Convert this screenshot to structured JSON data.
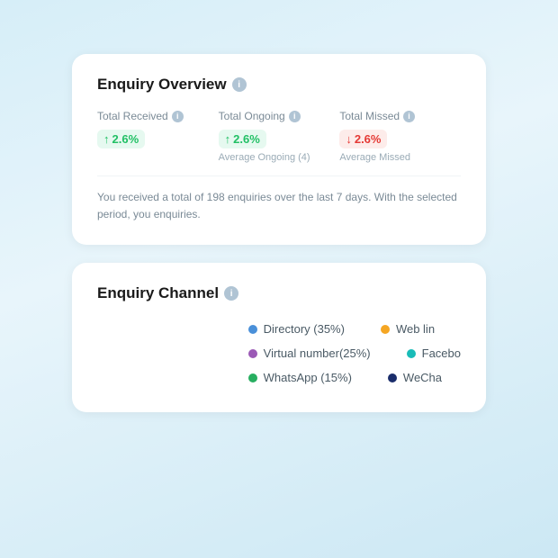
{
  "enquiryOverview": {
    "title": "Enquiry Overview",
    "infoIcon": "i",
    "stats": [
      {
        "label": "Total Received",
        "direction": "up",
        "value": "2.6%",
        "sub": ""
      },
      {
        "label": "Total Ongoing",
        "direction": "up",
        "value": "2.6%",
        "sub": "Average Ongoing (4)"
      },
      {
        "label": "Total Missed",
        "direction": "down",
        "value": "2.6%",
        "sub": "Average Missed"
      }
    ],
    "summary": "You received a total of 198 enquiries over the last 7 days. With the selected period, you enquiries."
  },
  "enquiryChannel": {
    "title": "Enquiry Channel",
    "infoIcon": "i",
    "legend": [
      [
        {
          "label": "Directory (35%)",
          "color": "#4a90d9"
        },
        {
          "label": "Web lin",
          "color": "#f5a623"
        }
      ],
      [
        {
          "label": "Virtual number(25%)",
          "color": "#9b59b6"
        },
        {
          "label": "Facebo",
          "color": "#1abcb8"
        }
      ],
      [
        {
          "label": "WhatsApp (15%)",
          "color": "#27ae60"
        },
        {
          "label": "WeCha",
          "color": "#1a2d6b"
        }
      ]
    ]
  }
}
